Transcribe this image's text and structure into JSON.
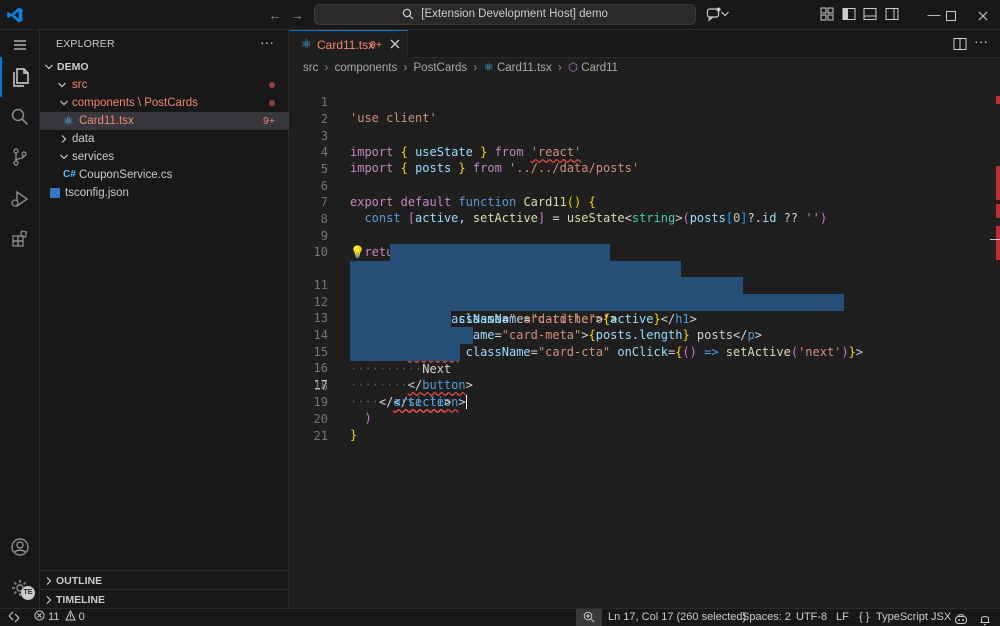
{
  "titlebar": {
    "command_center": "[Extension Development Host] demo",
    "back_icon": "arrow-left-icon",
    "forward_icon": "arrow-right-icon"
  },
  "sidebar": {
    "title": "EXPLORER",
    "more": "···",
    "root": "DEMO",
    "items": [
      {
        "label": "src",
        "kind": "folder",
        "status": "modified"
      },
      {
        "label": "components \\ PostCards",
        "kind": "folder",
        "status": "modified"
      },
      {
        "label": "Card11.tsx",
        "kind": "tsx",
        "badge": "9+",
        "selected": true
      },
      {
        "label": "data",
        "kind": "folder-collapsed"
      },
      {
        "label": "services",
        "kind": "folder"
      },
      {
        "label": "CouponService.cs",
        "kind": "cs"
      },
      {
        "label": "tsconfig.json",
        "kind": "json"
      }
    ],
    "outline": "OUTLINE",
    "timeline": "TIMELINE"
  },
  "tab": {
    "name": "Card11.tsx",
    "badge": "9+"
  },
  "breadcrumb": [
    "src",
    "components",
    "PostCards",
    "Card11.tsx",
    "Card11"
  ],
  "editor": {
    "line_numbers": [
      "1",
      "2",
      "3",
      "4",
      "5",
      "6",
      "7",
      "8",
      "9",
      "10",
      "11",
      "12",
      "13",
      "14",
      "15",
      "16",
      "17",
      "18",
      "19",
      "20",
      "21"
    ],
    "current_line": "17"
  },
  "statusbar": {
    "errors": "11",
    "warnings": "0",
    "position": "Ln 17, Col 17 (260 selected)",
    "spaces": "Spaces: 2",
    "encoding": "UTF-8",
    "eol": "LF",
    "language_braces": "{ }",
    "language": "TypeScript JSX"
  },
  "activity_badge": "TE",
  "colors": {
    "accent": "#0078d4",
    "modified": "#f48771",
    "selection": "#264f78",
    "error": "#f14c4c"
  }
}
